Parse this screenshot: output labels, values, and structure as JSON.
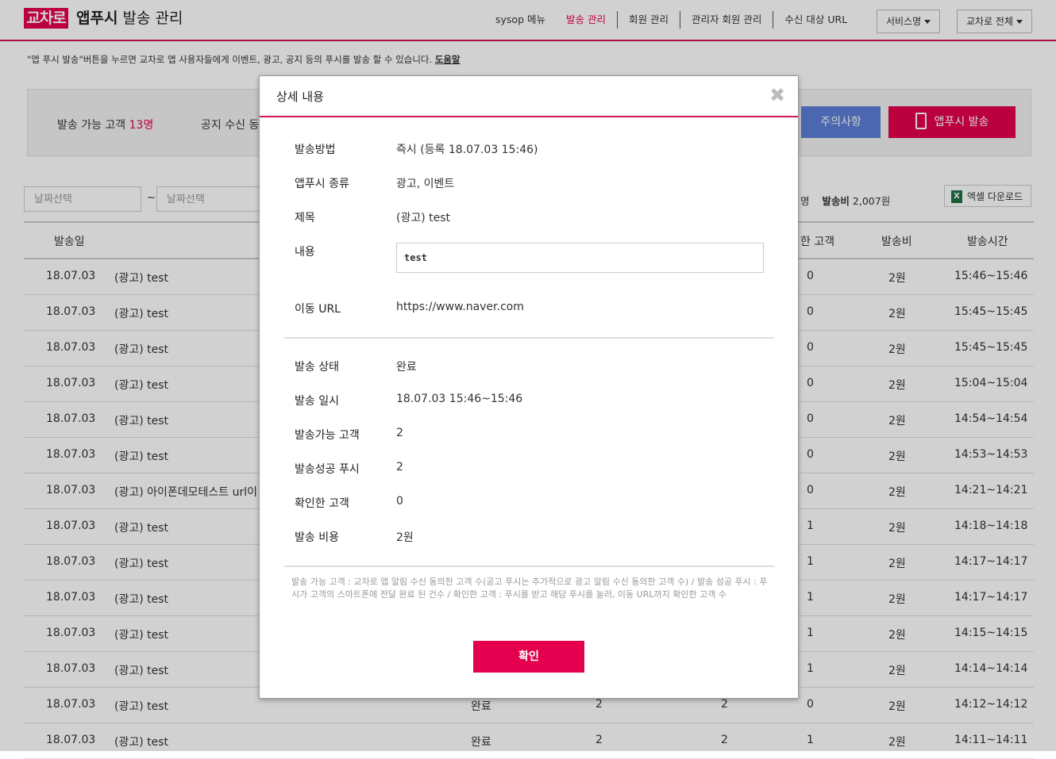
{
  "header": {
    "logo_text": "교차로",
    "title_bold": "앱푸시",
    "title_rest": " 발송 관리",
    "nav": [
      "sysop 메뉴",
      "발송 관리",
      "회원 관리",
      "관리자 회원 관리",
      "수신 대상 URL"
    ],
    "service_dropdown": "서비스명",
    "scope_dropdown": "교차로 전체"
  },
  "notice": {
    "text": "\"앱 푸시 발송\"버튼을 누르면 교차로 앱 사용자들에게 이벤트, 광고, 공지 등의 푸시를 발송 할 수 있습니다.",
    "help": "도움말"
  },
  "summary": {
    "available_label": "발송 가능 고객",
    "available_value": "13명",
    "notice_label": "공지 수신 동",
    "caution_button": "주의사항",
    "push_button": "앱푸시 발송"
  },
  "filter": {
    "date_from_placeholder": "날짜선택",
    "tilde": "~",
    "date_to_placeholder": "날짜선택",
    "stats_unit": "명",
    "stats_cost_label": "발송비",
    "stats_cost_value": "2,007원",
    "excel_button": "엑셀 다운로드"
  },
  "table": {
    "headers": [
      "발송일",
      "한 고객",
      "발송비",
      "발송시간"
    ],
    "rows": [
      {
        "date": "18.07.03",
        "title": "(광고) test",
        "status": "",
        "c1": "",
        "c2": "",
        "confirmed": "0",
        "cost": "2원",
        "time": "15:46~15:46"
      },
      {
        "date": "18.07.03",
        "title": "(광고) test",
        "status": "",
        "c1": "",
        "c2": "",
        "confirmed": "0",
        "cost": "2원",
        "time": "15:45~15:45"
      },
      {
        "date": "18.07.03",
        "title": "(광고) test",
        "status": "",
        "c1": "",
        "c2": "",
        "confirmed": "0",
        "cost": "2원",
        "time": "15:45~15:45"
      },
      {
        "date": "18.07.03",
        "title": "(광고) test",
        "status": "",
        "c1": "",
        "c2": "",
        "confirmed": "0",
        "cost": "2원",
        "time": "15:04~15:04"
      },
      {
        "date": "18.07.03",
        "title": "(광고) test",
        "status": "",
        "c1": "",
        "c2": "",
        "confirmed": "0",
        "cost": "2원",
        "time": "14:54~14:54"
      },
      {
        "date": "18.07.03",
        "title": "(광고) test",
        "status": "",
        "c1": "",
        "c2": "",
        "confirmed": "0",
        "cost": "2원",
        "time": "14:53~14:53"
      },
      {
        "date": "18.07.03",
        "title": "(광고) 아이폰데모테스트 url이",
        "status": "",
        "c1": "",
        "c2": "",
        "confirmed": "0",
        "cost": "2원",
        "time": "14:21~14:21"
      },
      {
        "date": "18.07.03",
        "title": "(광고) test",
        "status": "",
        "c1": "",
        "c2": "",
        "confirmed": "1",
        "cost": "2원",
        "time": "14:18~14:18"
      },
      {
        "date": "18.07.03",
        "title": "(광고) test",
        "status": "",
        "c1": "",
        "c2": "",
        "confirmed": "1",
        "cost": "2원",
        "time": "14:17~14:17"
      },
      {
        "date": "18.07.03",
        "title": "(광고) test",
        "status": "",
        "c1": "",
        "c2": "",
        "confirmed": "1",
        "cost": "2원",
        "time": "14:17~14:17"
      },
      {
        "date": "18.07.03",
        "title": "(광고) test",
        "status": "",
        "c1": "",
        "c2": "",
        "confirmed": "1",
        "cost": "2원",
        "time": "14:15~14:15"
      },
      {
        "date": "18.07.03",
        "title": "(광고) test",
        "status": "",
        "c1": "",
        "c2": "",
        "confirmed": "1",
        "cost": "2원",
        "time": "14:14~14:14"
      },
      {
        "date": "18.07.03",
        "title": "(광고) test",
        "status": "완료",
        "c1": "2",
        "c2": "2",
        "confirmed": "0",
        "cost": "2원",
        "time": "14:12~14:12"
      },
      {
        "date": "18.07.03",
        "title": "(광고) test",
        "status": "완료",
        "c1": "2",
        "c2": "2",
        "confirmed": "1",
        "cost": "2원",
        "time": "14:11~14:11"
      }
    ]
  },
  "modal": {
    "title": "상세 내용",
    "method_label": "발송방법",
    "method_value": "즉시 (등록 18.07.03 15:46)",
    "type_label": "앱푸시 종류",
    "type_value": "광고, 이벤트",
    "subject_label": "제목",
    "subject_value": "(광고) test",
    "content_label": "내용",
    "content_value": "test",
    "url_label": "이동 URL",
    "url_value": "https://www.naver.com",
    "status_label": "발송 상태",
    "status_value": "완료",
    "datetime_label": "발송 일시",
    "datetime_value": "18.07.03 15:46~15:46",
    "available_label": "발송가능 고객",
    "available_value": "2",
    "success_label": "발송성공 푸시",
    "success_value": "2",
    "confirmed_label": "확인한 고객",
    "confirmed_value": "0",
    "cost_label": "발송 비용",
    "cost_value": "2원",
    "footnote": "발송 가능 고객 : 교차로 앱 알림 수신 동의한 고객 수(공고 푸시는 추가적으로 광고 알림 수신 동의한 고객 수) / 발송 성공 푸시 : 푸시가 고객의 스마트폰에 전달 완료 된 건수 / 확인한 고객 : 푸시를 받고 해당 푸시를 눌러, 이동 URL까지 확인한 고객 수",
    "ok_button": "확인"
  }
}
